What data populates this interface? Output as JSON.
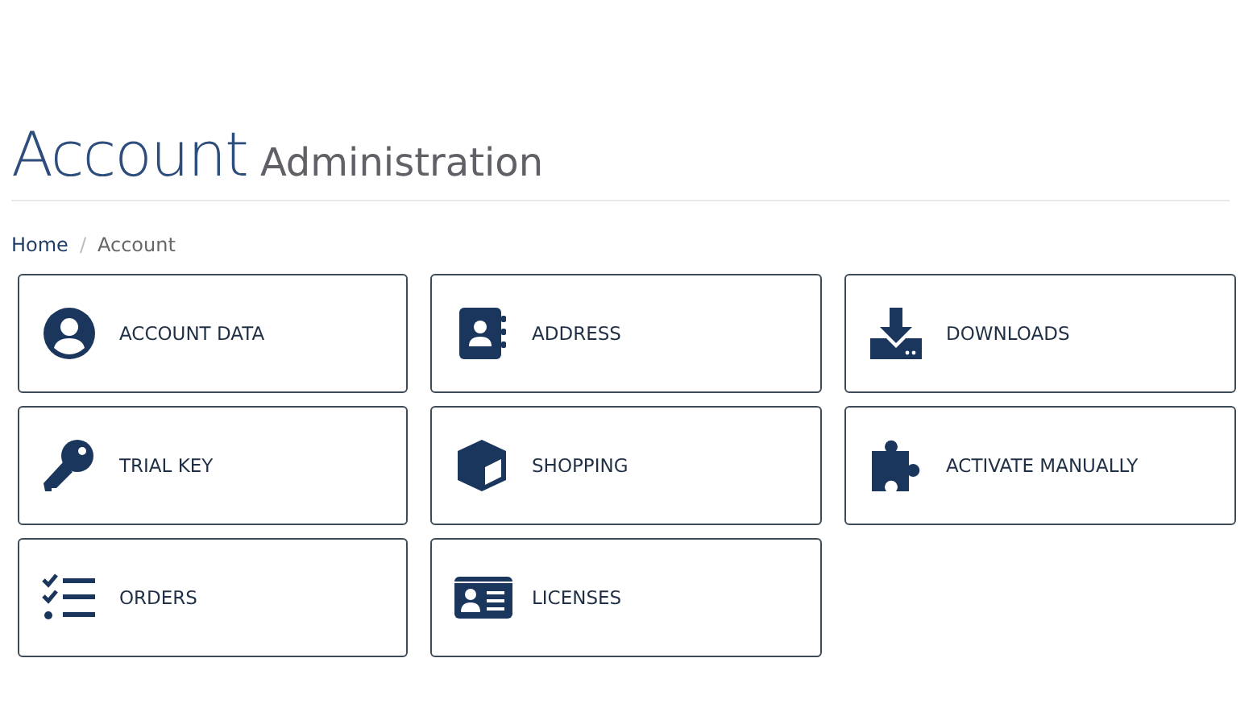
{
  "heading": {
    "title": "Account",
    "subtitle": "Administration"
  },
  "breadcrumb": [
    {
      "label": "Home",
      "kind": "link"
    },
    {
      "label": "/",
      "kind": "separator"
    },
    {
      "label": "Account",
      "kind": "current"
    }
  ],
  "tiles": [
    {
      "label": "ACCOUNT DATA",
      "kind": "user"
    },
    {
      "label": "ADDRESS",
      "kind": "addressbook"
    },
    {
      "label": "DOWNLOADS",
      "kind": "download"
    },
    {
      "label": "TRIAL KEY",
      "kind": "key"
    },
    {
      "label": "SHOPPING",
      "kind": "box"
    },
    {
      "label": "ACTIVATE MANUALLY",
      "kind": "puzzle"
    },
    {
      "label": "ORDERS",
      "kind": "list"
    },
    {
      "label": "LICENSES",
      "kind": "idcard"
    }
  ]
}
